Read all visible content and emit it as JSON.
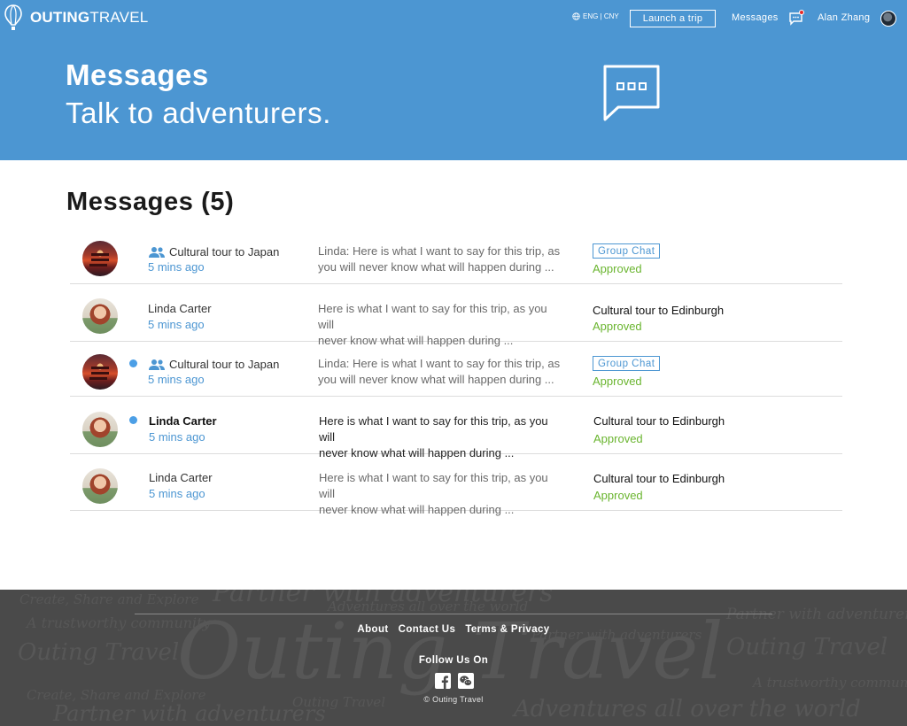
{
  "brand": {
    "name_bold": "OUTING",
    "name_light": "TRAVEL"
  },
  "nav": {
    "lang": "ENG | CNY",
    "launch_label": "Launch a trip",
    "messages_label": "Messages",
    "user_name": "Alan Zhang"
  },
  "hero": {
    "title": "Messages",
    "subtitle": "Talk to adventurers."
  },
  "main": {
    "heading": "Messages (5)",
    "messages": [
      {
        "title": "Cultural tour to Japan",
        "group": true,
        "unread": false,
        "time": "5 mins ago",
        "preview_1": "Linda: Here is what I want to say for this trip, as",
        "preview_2": "you will never know what will happen during ...",
        "badge": "Group Chat",
        "trip": "",
        "status": "Approved"
      },
      {
        "title": "Linda Carter",
        "group": false,
        "unread": false,
        "time": "5 mins ago",
        "preview_1": "Here is what I want to say for this trip, as you will",
        "preview_2": "never know what will happen during ...",
        "badge": "",
        "trip": "Cultural tour to Edinburgh",
        "status": "Approved"
      },
      {
        "title": "Cultural tour to Japan",
        "group": true,
        "unread": true,
        "time": "5 mins ago",
        "preview_1": "Linda: Here is what I want to say for this trip, as",
        "preview_2": "you will never know what will happen during ...",
        "badge": "Group Chat",
        "trip": "",
        "status": "Approved"
      },
      {
        "title": "Linda Carter",
        "group": false,
        "unread": true,
        "time": "5 mins ago",
        "preview_1": "Here is what I want to say for this trip, as you will",
        "preview_2": "never know what will happen during ...",
        "badge": "",
        "trip": "Cultural tour to Edinburgh",
        "status": "Approved"
      },
      {
        "title": "Linda Carter",
        "group": false,
        "unread": false,
        "time": "5 mins ago",
        "preview_1": "Here is what I want to say for this trip, as you will",
        "preview_2": "never know what will happen during ...",
        "badge": "",
        "trip": "Cultural tour to Edinburgh",
        "status": "Approved"
      }
    ]
  },
  "footer": {
    "links": [
      "About",
      "Contact Us",
      "Terms & Privacy"
    ],
    "follow_label": "Follow Us On",
    "copyright": "© Outing Travel",
    "watermark": {
      "big": "Outing Travel",
      "slogans": [
        "Create, Share and Explore",
        "A trustworthy community",
        "Partner with adventurers",
        "Adventures all over the world",
        "Outing Travel"
      ]
    }
  },
  "colors": {
    "primary": "#4c96d2",
    "approved": "#6ab52f",
    "footer_bg": "#4a4a4a",
    "unread_dot": "#4c9fe6"
  },
  "icons": [
    "balloon-logo-icon",
    "globe-icon",
    "chat-icon",
    "speech-bubble-icon",
    "group-icon",
    "facebook-icon",
    "wechat-icon"
  ]
}
